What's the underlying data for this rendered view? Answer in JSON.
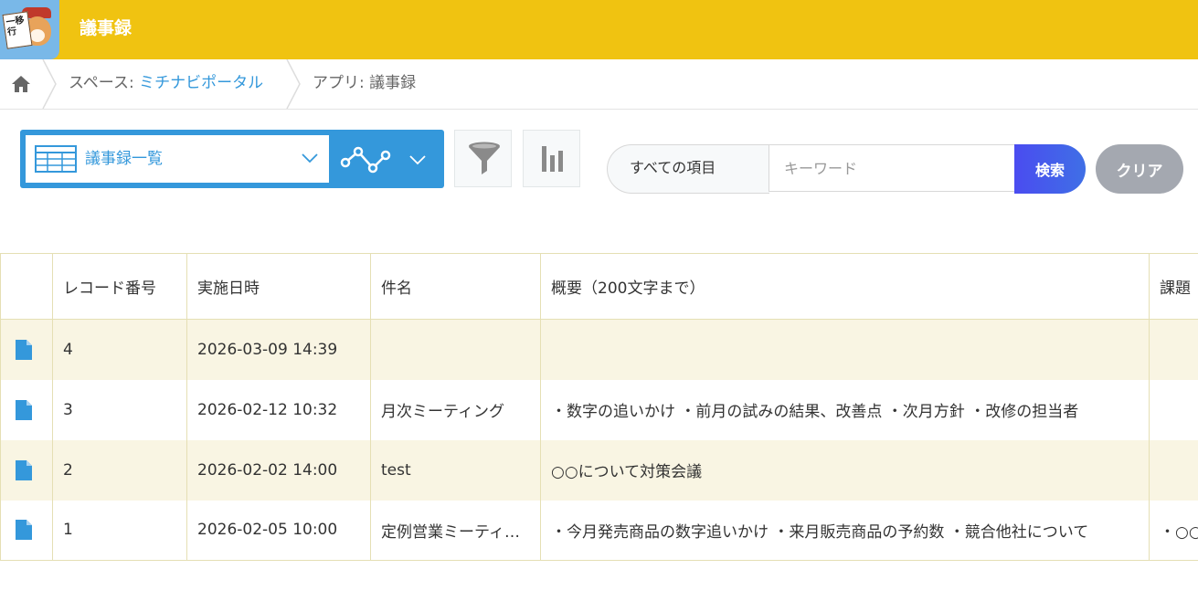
{
  "header": {
    "app_title": "議事録",
    "logo_text": "一移行",
    "color": "#f0c311"
  },
  "breadcrumb": {
    "space_prefix": "スペース: ",
    "space_name": "ミチナビポータル",
    "app_label": "アプリ: 議事録"
  },
  "toolbar": {
    "view_name": "議事録一覧",
    "accent": "#3498db"
  },
  "search": {
    "scope": "すべての項目",
    "placeholder": "キーワード",
    "search_label": "検索",
    "clear_label": "クリア"
  },
  "table": {
    "columns": [
      "",
      "レコード番号",
      "実施日時",
      "件名",
      "概要（200文字まで）",
      "課題"
    ],
    "rows": [
      {
        "id": "4",
        "datetime": "2026-03-09 14:39",
        "subject": "",
        "summary": "",
        "issue": ""
      },
      {
        "id": "3",
        "datetime": "2026-02-12 10:32",
        "subject": "月次ミーティング",
        "summary": "・数字の追いかけ ・前月の試みの結果、改善点 ・次月方針 ・改修の担当者",
        "issue": ""
      },
      {
        "id": "2",
        "datetime": "2026-02-02 14:00",
        "subject": "test",
        "summary": "○○について対策会議",
        "issue": ""
      },
      {
        "id": "1",
        "datetime": "2026-02-05 10:00",
        "subject": "定例営業ミーティング",
        "summary": "・今月発売商品の数字追いかけ ・来月販売商品の予約数 ・競合他社について",
        "issue": "・○○"
      }
    ]
  }
}
